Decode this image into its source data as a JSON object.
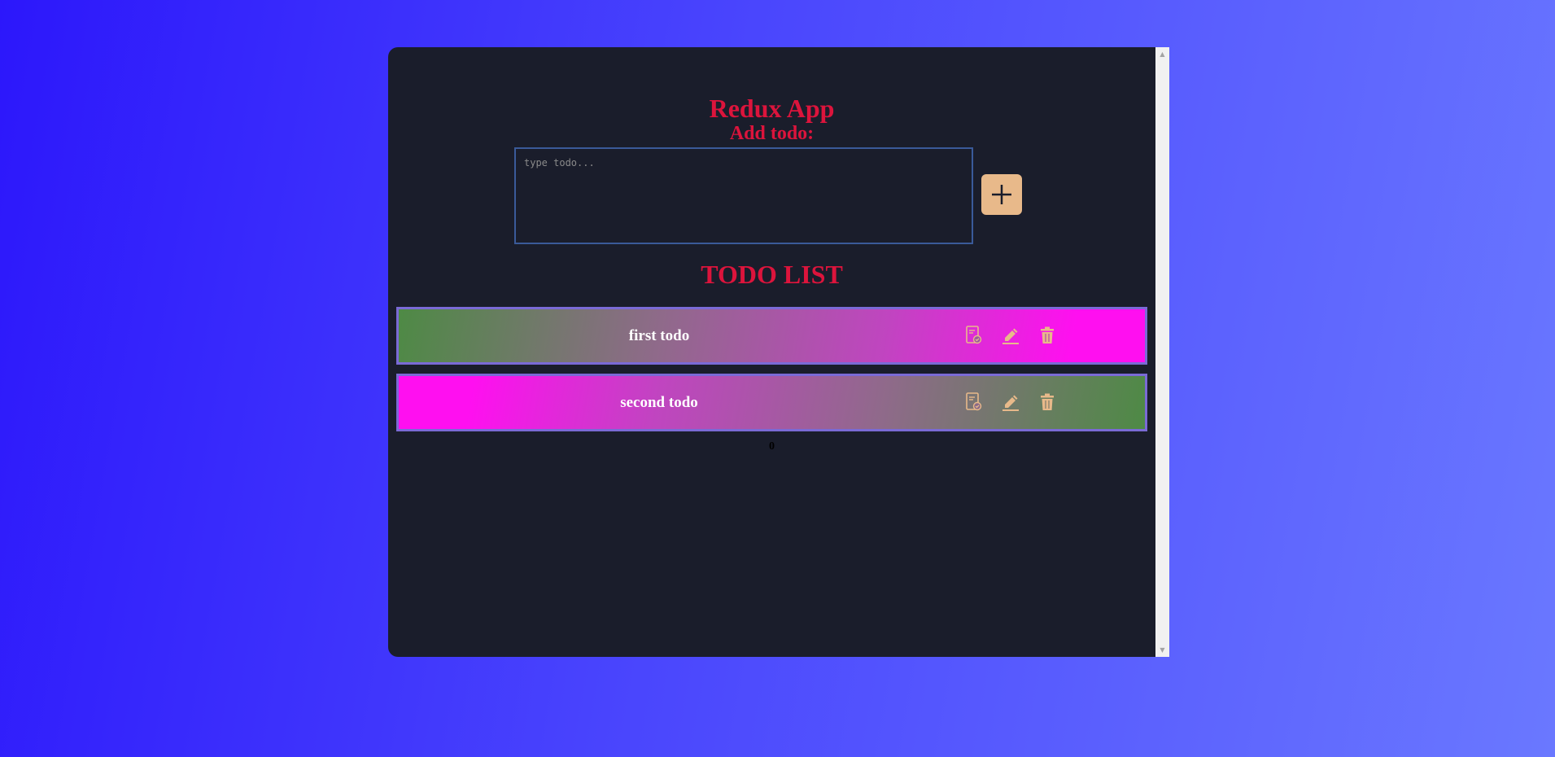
{
  "header": {
    "title": "Redux App",
    "subtitle": "Add todo:"
  },
  "input": {
    "placeholder": "type todo...",
    "value": ""
  },
  "add_button": {
    "icon": "plus-icon"
  },
  "list": {
    "title": "TODO LIST",
    "items": [
      {
        "text": "first todo",
        "actions": [
          "complete-icon",
          "edit-icon",
          "delete-icon"
        ]
      },
      {
        "text": "second todo",
        "actions": [
          "complete-icon",
          "edit-icon",
          "delete-icon"
        ]
      }
    ]
  },
  "counter": "0",
  "colors": {
    "title": "#dc143c",
    "panel": "#1a1d2b",
    "icon": "#e8b98a",
    "item_border": "#7a6ad6"
  }
}
